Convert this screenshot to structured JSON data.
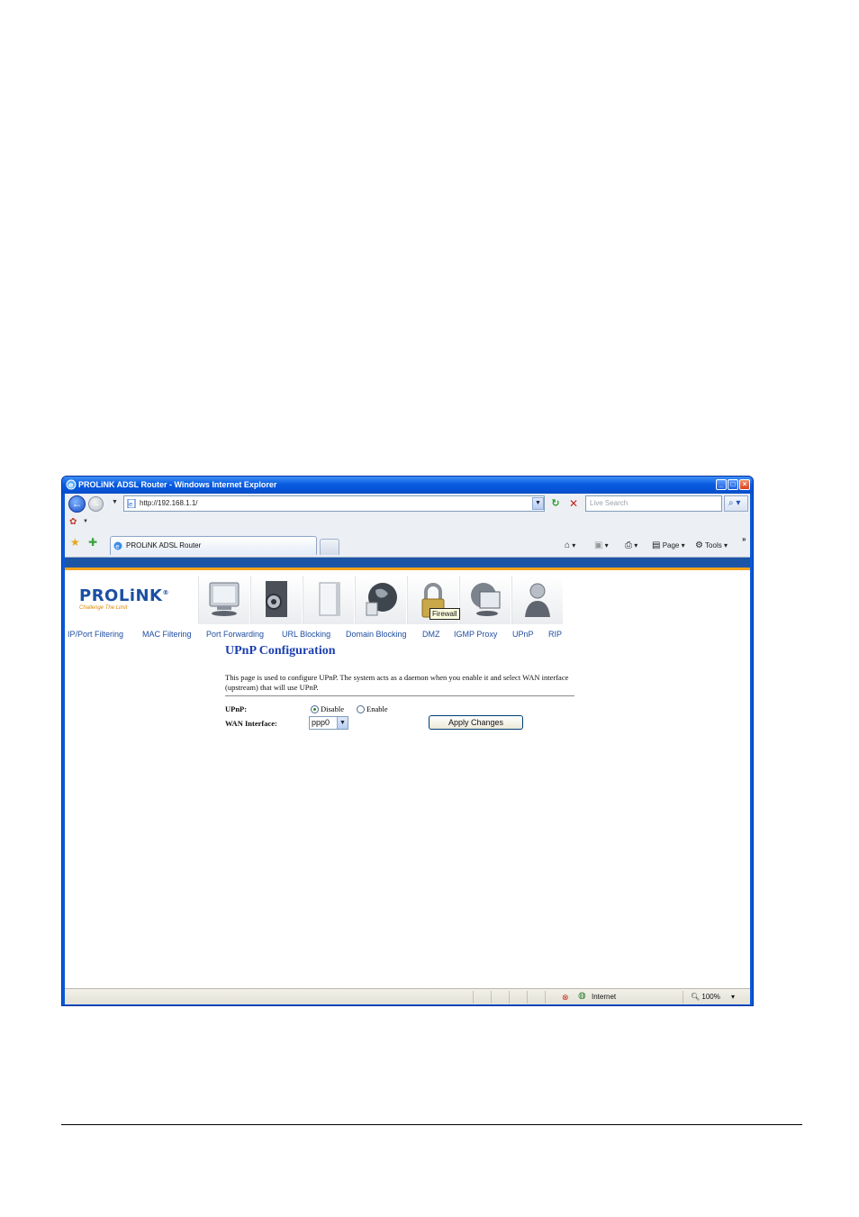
{
  "window": {
    "title": "PROLiNK ADSL Router - Windows Internet Explorer",
    "buttons": {
      "minimize": "_",
      "maximize": "□",
      "close": "×"
    }
  },
  "toolbar": {
    "address": "http://192.168.1.1/",
    "search_placeholder": "Live Search",
    "back_glyph": "←",
    "forward_glyph": "→",
    "refresh_glyph": "↻",
    "stop_glyph": "✕",
    "search_glyph": "⌕ ▾",
    "tab_title": "PROLiNK ADSL Router",
    "page_menu": "Page",
    "tools_menu": "Tools",
    "chevrons": "»"
  },
  "router": {
    "brand": "PROLiNK",
    "registered": "®",
    "tagline": "Challenge The Limit",
    "icons": [
      "status-icon",
      "setup-icon",
      "advanced-icon",
      "service-icon",
      "firewall-icon",
      "maintenance-icon",
      "admin-icon"
    ],
    "tooltip": "Firewall",
    "submenu": [
      "IP/Port Filtering",
      "MAC Filtering",
      "Port Forwarding",
      "URL Blocking",
      "Domain Blocking",
      "DMZ",
      "IGMP Proxy",
      "UPnP",
      "RIP"
    ]
  },
  "page": {
    "title": "UPnP Configuration",
    "description": "This page is used to configure UPnP. The system acts as a daemon when you enable it and select WAN interface (upstream) that will use UPnP.",
    "upnp_label": "UPnP:",
    "upnp_options": [
      "Disable",
      "Enable"
    ],
    "upnp_selected": "Disable",
    "wan_label": "WAN Interface:",
    "wan_value": "ppp0",
    "apply_label": "Apply Changes"
  },
  "statusbar": {
    "zone": "Internet",
    "zoom": "100%"
  },
  "colors": {
    "title_blue": "#1b3fb0",
    "brand_blue": "#1b4fa3",
    "accent_orange": "#f3a21b",
    "band_blue": "#1d55a6"
  }
}
